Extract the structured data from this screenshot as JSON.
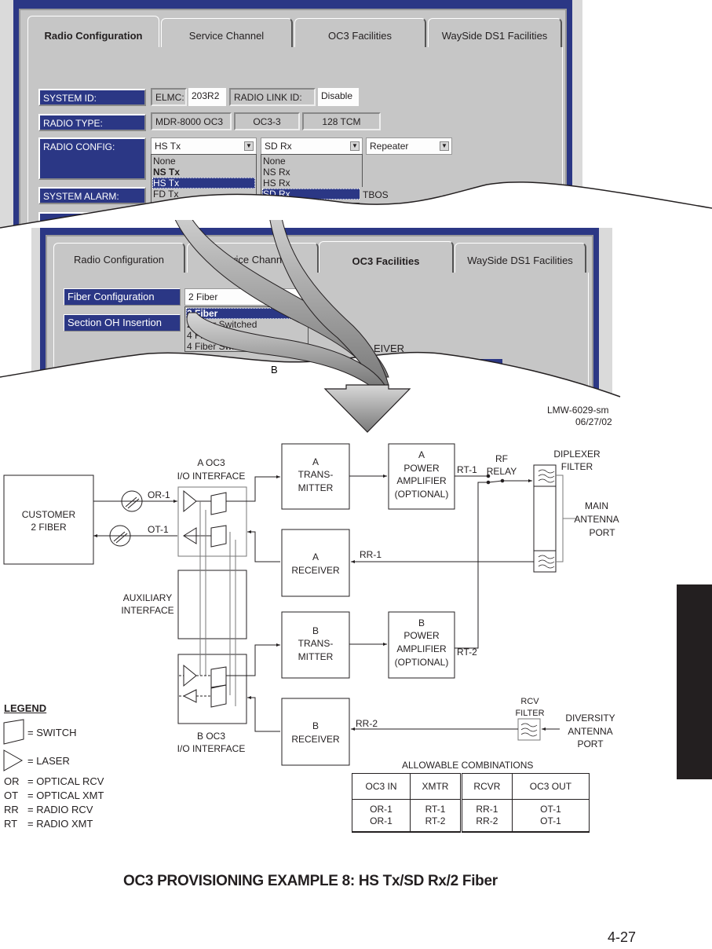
{
  "screen1": {
    "tabs": [
      {
        "label": "Radio Configuration",
        "active": true
      },
      {
        "label": "Service Channel",
        "active": false
      },
      {
        "label": "OC3 Facilities",
        "active": false
      },
      {
        "label": "WaySide DS1 Facilities",
        "active": false
      }
    ],
    "system_id": {
      "label": "SYSTEM ID:",
      "elmc_label": "ELMC:",
      "elmc_value": "203R2",
      "radio_link_label": "RADIO LINK ID:",
      "radio_link_value": "Disable"
    },
    "radio_type": {
      "label": "RADIO TYPE:",
      "values": [
        "MDR-8000 OC3",
        "OC3-3",
        "128 TCM"
      ]
    },
    "radio_config": {
      "label": "RADIO CONFIG:",
      "tx_select": {
        "value": "HS Tx",
        "options": [
          "None",
          "NS Tx",
          "HS Tx",
          "FD Tx"
        ],
        "highlighted": "HS Tx"
      },
      "rx_select": {
        "value": "SD Rx",
        "options": [
          "None",
          "NS Rx",
          "HS Rx",
          "SD Rx"
        ],
        "highlighted": "SD Rx"
      },
      "mode_select": {
        "value": "Repeater"
      }
    },
    "system_alarm": {
      "label": "SYSTEM ALARM:",
      "partial_value": "TBOS"
    }
  },
  "screen2": {
    "tabs": [
      {
        "label": "Radio Configuration",
        "active": false
      },
      {
        "label": "Service Channel",
        "active": false
      },
      {
        "label": "OC3 Facilities",
        "active": true
      },
      {
        "label": "WaySide DS1 Facilities",
        "active": false
      }
    ],
    "fiber_config": {
      "label": "Fiber Configuration",
      "value": "2 Fiber",
      "options": [
        "2 Fiber",
        "2 Fiber Switched",
        "4 Fiber",
        "4 Fiber Switched"
      ],
      "highlighted": "2 Fiber"
    },
    "section_oh": {
      "label": "Section OH Insertion"
    },
    "partial_text": [
      "EIVER",
      "B"
    ]
  },
  "figure_id": {
    "code": "LMW-6029-sm",
    "date": "06/27/02"
  },
  "diagram": {
    "customer": [
      "CUSTOMER",
      "2 FIBER"
    ],
    "a_oc3": [
      "A OC3",
      "I/O INTERFACE"
    ],
    "b_oc3": [
      "B OC3",
      "I/O INTERFACE"
    ],
    "aux": [
      "AUXILIARY",
      "INTERFACE"
    ],
    "a_tx": [
      "A",
      "TRANS-",
      "MITTER"
    ],
    "a_rx": [
      "A",
      "RECEIVER"
    ],
    "b_tx": [
      "B",
      "TRANS-",
      "MITTER"
    ],
    "b_rx": [
      "B",
      "RECEIVER"
    ],
    "a_pa": [
      "A",
      "POWER",
      "AMPLIFIER",
      "(OPTIONAL)"
    ],
    "b_pa": [
      "B",
      "POWER",
      "AMPLIFIER",
      "(OPTIONAL)"
    ],
    "rf_relay": [
      "RF",
      "RELAY"
    ],
    "diplexer": [
      "DIPLEXER",
      "FILTER"
    ],
    "main_ant": [
      "MAIN",
      "ANTENNA",
      "PORT"
    ],
    "rcv_filter": [
      "RCV",
      "FILTER"
    ],
    "div_ant": [
      "DIVERSITY",
      "ANTENNA",
      "PORT"
    ],
    "signals": {
      "or1": "OR-1",
      "ot1": "OT-1",
      "rt1": "RT-1",
      "rt2": "RT-2",
      "rr1": "RR-1",
      "rr2": "RR-2"
    }
  },
  "legend": {
    "title": "LEGEND",
    "switch": "= SWITCH",
    "laser": "= LASER",
    "abbrevs": [
      {
        "key": "OR",
        "desc": "= OPTICAL RCV"
      },
      {
        "key": "OT",
        "desc": "= OPTICAL XMT"
      },
      {
        "key": "RR",
        "desc": "= RADIO RCV"
      },
      {
        "key": "RT",
        "desc": "= RADIO XMT"
      }
    ]
  },
  "combinations": {
    "title": "ALLOWABLE COMBINATIONS",
    "headers": [
      "OC3 IN",
      "XMTR",
      "RCVR",
      "OC3 OUT"
    ],
    "rows": [
      [
        "OR-1",
        "RT-1",
        "RR-1",
        "OT-1"
      ],
      [
        "OR-1",
        "RT-2",
        "RR-2",
        "OT-1"
      ]
    ]
  },
  "caption": "OC3 PROVISIONING EXAMPLE 8:  HS Tx/SD Rx/2 Fiber",
  "page_number": "4-27"
}
